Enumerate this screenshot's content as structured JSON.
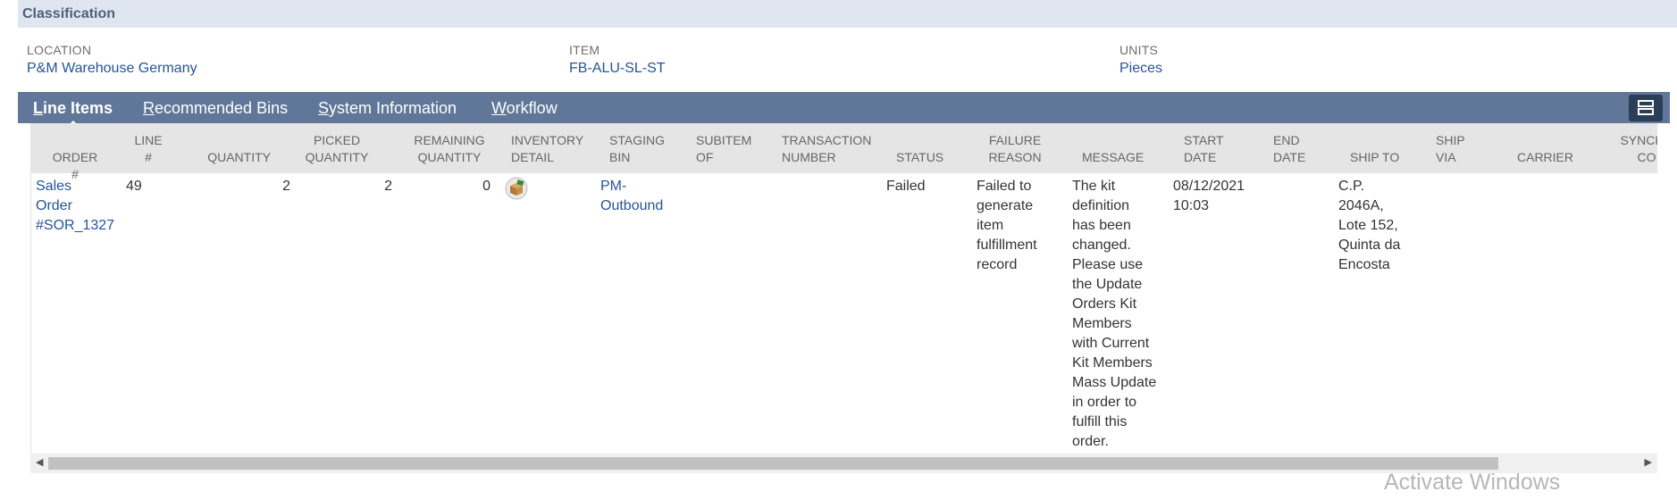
{
  "section": {
    "title": "Classification"
  },
  "fields": {
    "location": {
      "label": "LOCATION",
      "value": "P&M Warehouse Germany"
    },
    "item": {
      "label": "ITEM",
      "value": "FB-ALU-SL-ST"
    },
    "units": {
      "label": "UNITS",
      "value": "Pieces"
    }
  },
  "tabs": [
    {
      "first": "L",
      "rest": "ine Items"
    },
    {
      "first": "R",
      "rest": "ecommended Bins"
    },
    {
      "first": "S",
      "rest": "ystem Information"
    },
    {
      "first": "W",
      "rest": "orkflow"
    }
  ],
  "columns": {
    "order": "ORDER #",
    "line": "LINE\n#",
    "quantity": "QUANTITY",
    "picked": "PICKED\nQUANTITY",
    "remaining": "REMAINING\nQUANTITY",
    "inventory": "INVENTORY\nDETAIL",
    "staging": "STAGING\nBIN",
    "subitem": "SUBITEM\nOF",
    "transaction": "TRANSACTION\nNUMBER",
    "status": "STATUS",
    "failure": "FAILURE\nREASON",
    "message": "MESSAGE",
    "start": "START\nDATE",
    "end": "END\nDATE",
    "shipto": "SHIP TO",
    "shipvia": "SHIP\nVIA",
    "carrier": "CARRIER",
    "synch": "SYNCHR\nCO"
  },
  "row": {
    "order": "Sales\nOrder\n#SOR_1327",
    "line": "49",
    "quantity": "2",
    "picked": "2",
    "remaining": "0",
    "inventory_icon": "inventory-box-icon",
    "staging": "PM-\nOutbound",
    "status": "Failed",
    "failure": "Failed to\ngenerate\nitem\nfulfillment\nrecord",
    "message": "The kit\ndefinition\nhas been\nchanged.\nPlease use\nthe Update\nOrders Kit\nMembers\nwith Current\nKit Members\nMass Update\nin order to\nfulfill this\norder.",
    "start": "08/12/2021\n10:03",
    "shipto": "C.P.\n2046A,\nLote 152,\nQuinta da\nEncosta"
  },
  "watermark": "Activate Windows",
  "colors": {
    "header_bg": "#e0e6ef",
    "tabbar_bg": "#607799",
    "link": "#255599",
    "table_header_bg": "#e5e5e5"
  }
}
